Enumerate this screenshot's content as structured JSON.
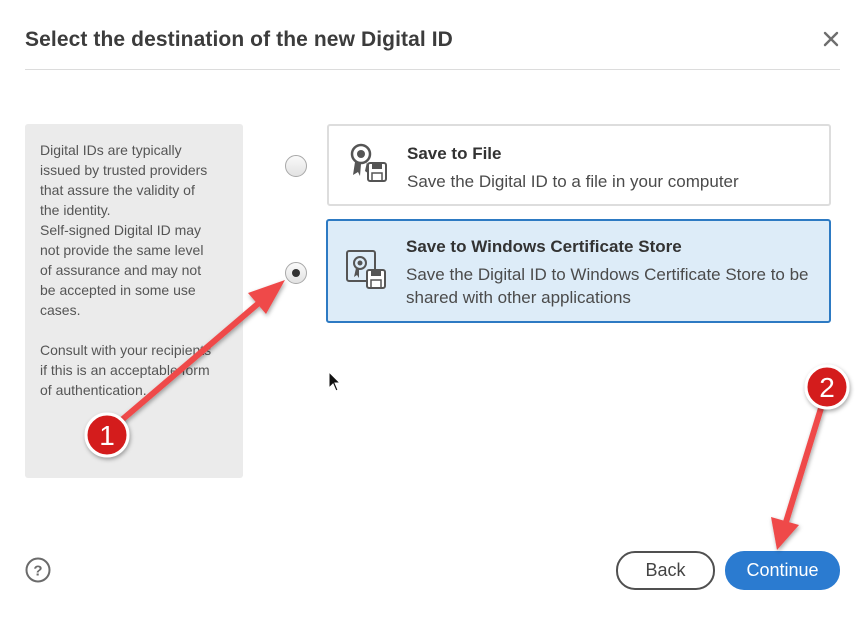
{
  "dialog": {
    "title": "Select the destination of the new Digital ID",
    "close_icon": "close-icon"
  },
  "info": {
    "paragraph1_lines": [
      "Digital IDs are typically",
      "issued by trusted providers",
      "that assure the validity of",
      "the identity.",
      "Self-signed Digital ID may",
      "not provide the same level",
      "of assurance and may not",
      "be accepted in some use",
      "cases."
    ],
    "paragraph2_lines": [
      "Consult with your recipients",
      "if this is an acceptable form",
      "of authentication."
    ]
  },
  "options": [
    {
      "title": "Save to File",
      "description": "Save the Digital ID to a file in your computer",
      "selected": false,
      "icon": "certificate-file-icon"
    },
    {
      "title": "Save to Windows Certificate Store",
      "description": "Save the Digital ID to Windows Certificate Store to be shared with other applications",
      "selected": true,
      "icon": "certificate-store-icon"
    }
  ],
  "footer": {
    "help_icon": "help-icon",
    "back_label": "Back",
    "continue_label": "Continue"
  },
  "annotations": {
    "step1_label": "1",
    "step2_label": "2",
    "badge_color": "#d41a1a",
    "arrow_color": "#ef4a4a"
  },
  "colors": {
    "accent": "#2b7bd0",
    "selected_bg": "#ddecf8",
    "selected_border": "#2d7ac3",
    "panel_bg": "#ebebeb"
  }
}
